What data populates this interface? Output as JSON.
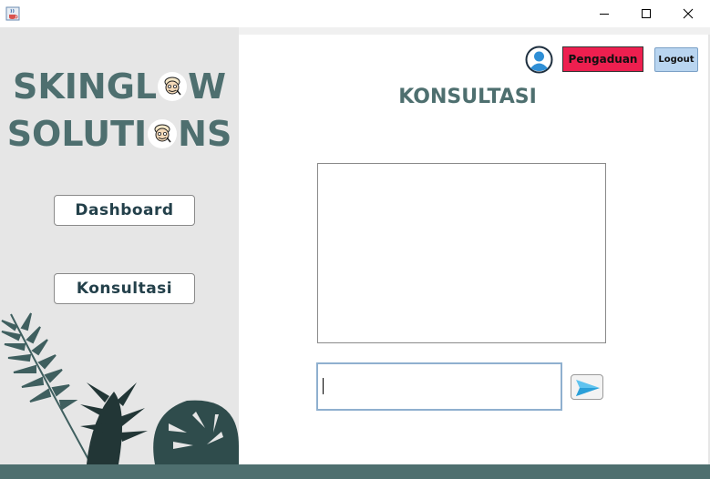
{
  "window": {
    "app_icon": "java-cup-icon",
    "controls": [
      "minimize-icon",
      "maximize-icon",
      "close-icon"
    ]
  },
  "sidebar": {
    "brand_line1": {
      "before": "SKINGL",
      "after": "W"
    },
    "brand_line2": {
      "before": "SOLUTI",
      "after": "NS"
    },
    "brand_icon": "face-mask-icon",
    "nav": [
      {
        "label": "Dashboard"
      },
      {
        "label": "Konsultasi"
      }
    ],
    "decoration": "tropical-leaves"
  },
  "header": {
    "user_icon": "user-avatar-icon",
    "complaint_button": "Pengaduan",
    "logout_button": "Logout"
  },
  "main": {
    "title": "KONSULTASI",
    "chat_text": "",
    "message_value": "",
    "send_icon": "paper-plane-icon"
  },
  "colors": {
    "brand": "#4e6f6f",
    "complaint": "#ee1f4f",
    "logout": "#b9d5f0",
    "sidebar_bg": "#e6e6e6"
  }
}
